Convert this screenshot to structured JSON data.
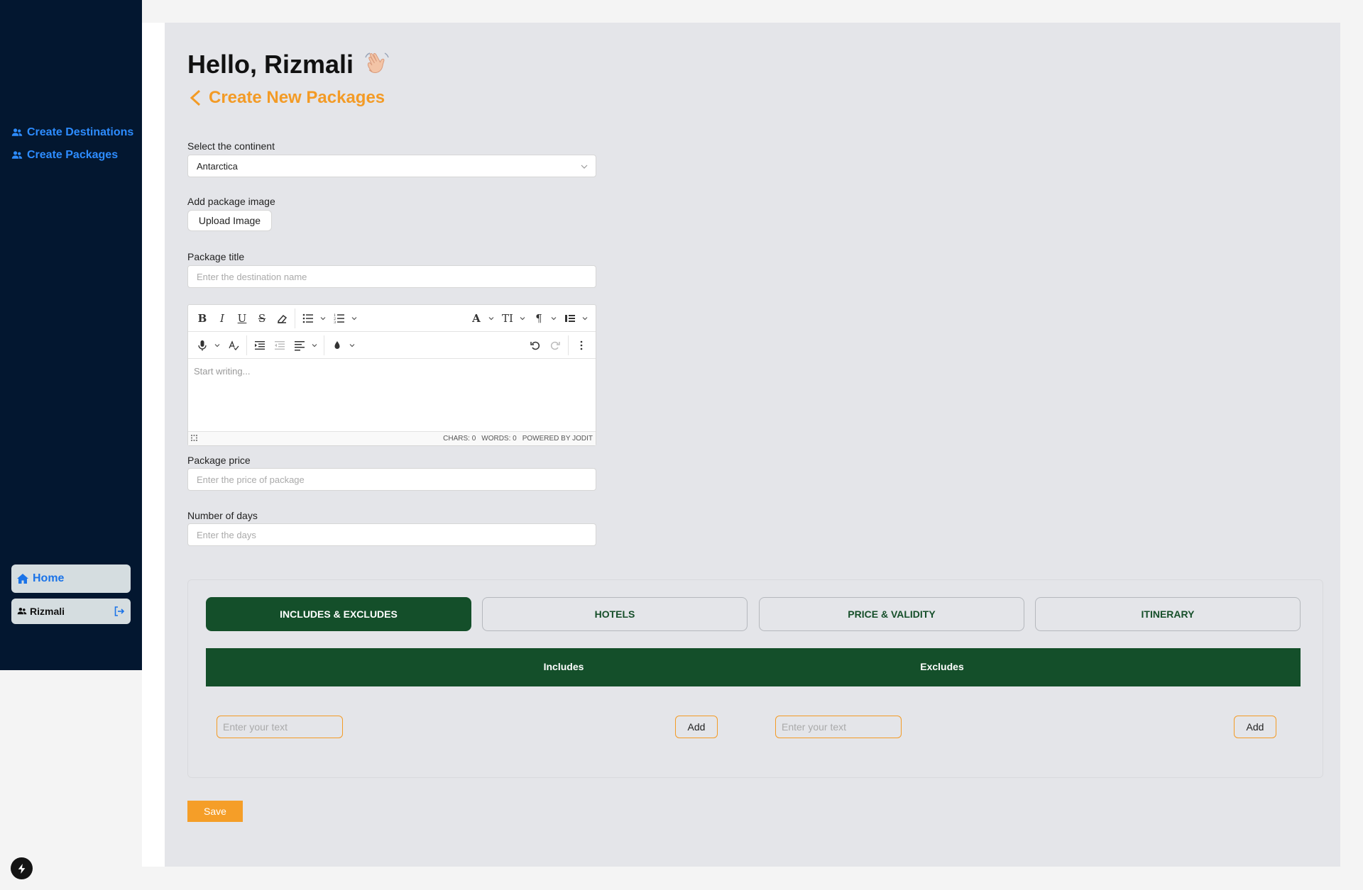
{
  "sidebar": {
    "links": [
      {
        "label": "Create Destinations"
      },
      {
        "label": "Create Packages"
      }
    ],
    "home_label": "Home",
    "user_name": "Rizmali"
  },
  "header": {
    "greeting": "Hello, Rizmali",
    "page_title": "Create New Packages"
  },
  "form": {
    "continent_label": "Select the continent",
    "continent_value": "Antarctica",
    "image_label": "Add package image",
    "upload_label": "Upload Image",
    "title_label": "Package title",
    "title_placeholder": "Enter the destination name",
    "editor_placeholder": "Start writing...",
    "editor_chars": "CHARS: 0",
    "editor_words": "WORDS: 0",
    "editor_powered": "POWERED BY JODIT",
    "price_label": "Package price",
    "price_placeholder": "Enter the price of package",
    "days_label": "Number of days",
    "days_placeholder": "Enter the days"
  },
  "tabs": [
    {
      "label": "INCLUDES & EXCLUDES",
      "active": true
    },
    {
      "label": "HOTELS",
      "active": false
    },
    {
      "label": "PRICE & VALIDITY",
      "active": false
    },
    {
      "label": "ITINERARY",
      "active": false
    }
  ],
  "includes_excludes": {
    "includes_header": "Includes",
    "excludes_header": "Excludes",
    "input_placeholder": "Enter your text",
    "add_label": "Add"
  },
  "save_label": "Save",
  "colors": {
    "sidebar_bg": "#031730",
    "accent_orange": "#f39b26",
    "tab_green": "#144f2a",
    "link_blue": "#2d8cff"
  }
}
